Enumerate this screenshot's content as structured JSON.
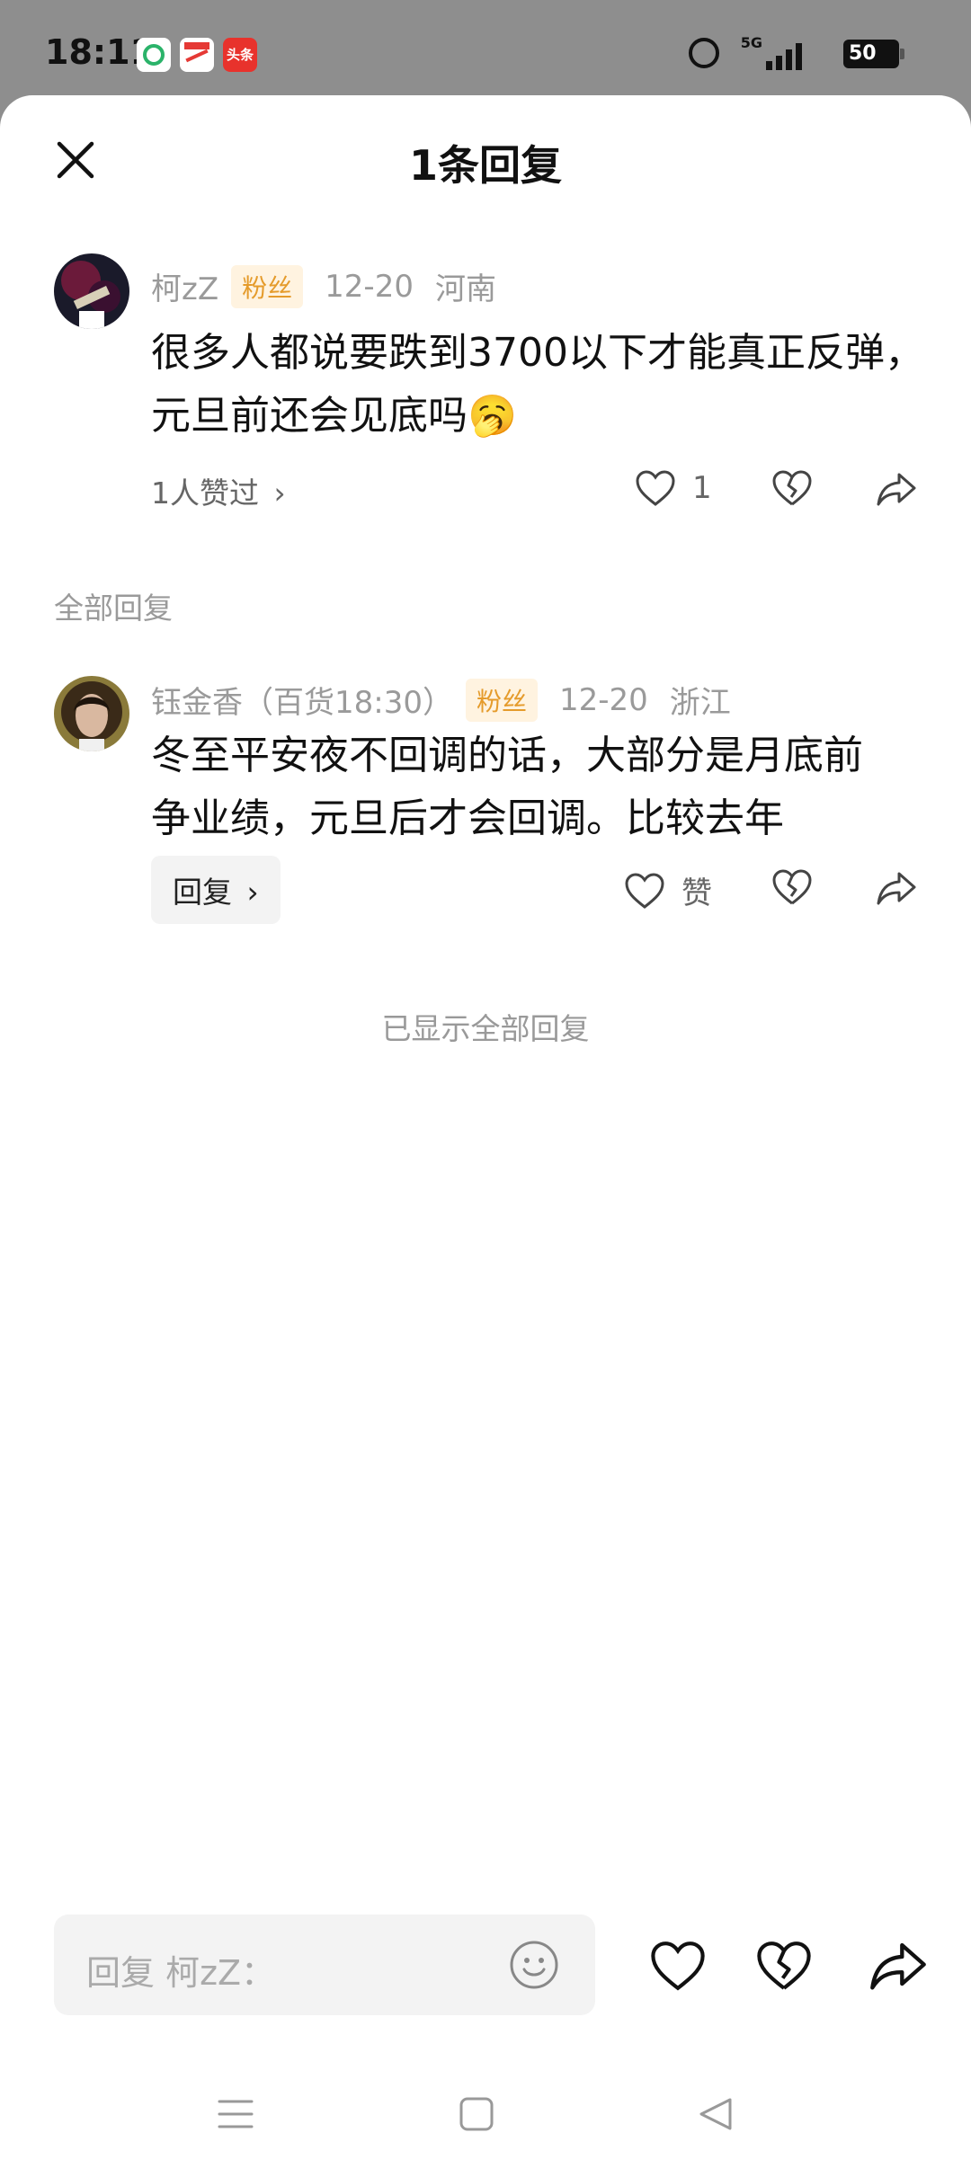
{
  "status_bar": {
    "time": "18:11",
    "app3_label": "头条",
    "network": "5G",
    "battery": "50"
  },
  "header": {
    "title": "1条回复"
  },
  "main_comment": {
    "author": "柯zZ",
    "badge": "粉丝",
    "date": "12-20",
    "location": "河南",
    "text": "很多人都说要跌到3700以下才能真正反弹，元旦前还会见底吗🥱",
    "likes_link": "1人赞过",
    "like_count": "1"
  },
  "replies_section": {
    "label": "全部回复"
  },
  "reply": {
    "author": "钰金香（百货18:30）",
    "badge": "粉丝",
    "date": "12-20",
    "location": "浙江",
    "text": "冬至平安夜不回调的话，大部分是月底前争业绩，元旦后才会回调。比较去年",
    "reply_button": "回复",
    "like_label": "赞"
  },
  "footer_text": "已显示全部回复",
  "input": {
    "placeholder": "回复 柯zZ："
  },
  "colors": {
    "badge_bg": "#fff3e0",
    "badge_text": "#e59b2b",
    "sheet_bg": "#ffffff",
    "overlay_bg": "#8e8e8e"
  }
}
